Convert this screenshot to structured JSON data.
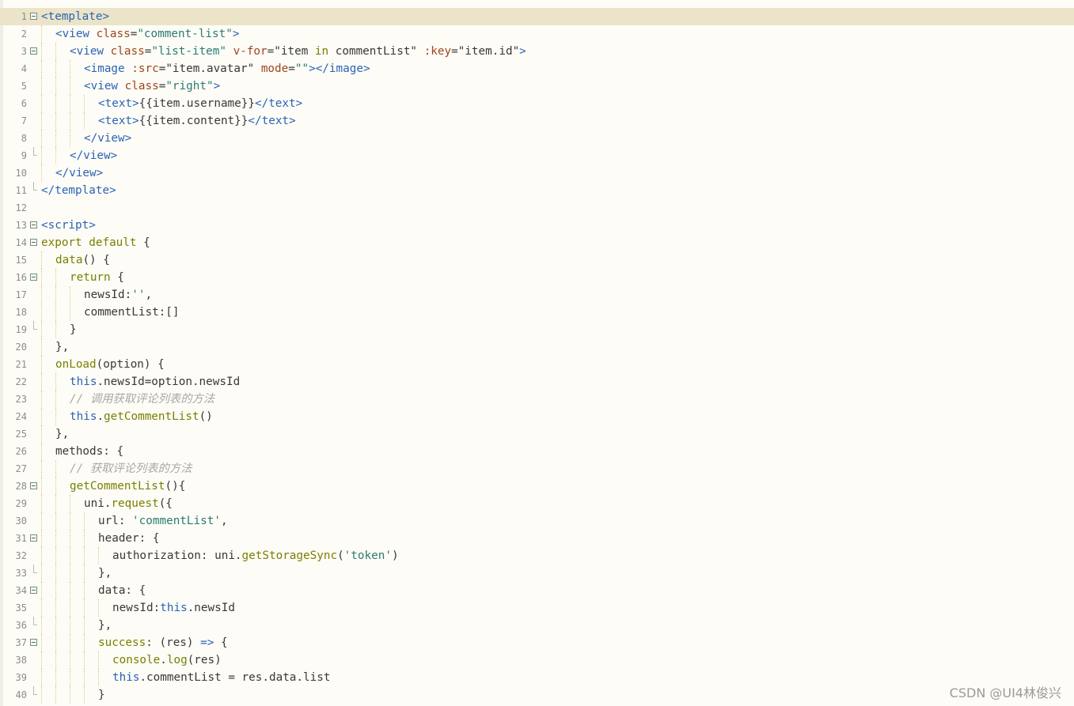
{
  "editor": {
    "lines": [
      {
        "n": "1",
        "fold": "box",
        "current": true,
        "indent": 0,
        "tokens": [
          [
            "tag",
            "<template>"
          ]
        ]
      },
      {
        "n": "2",
        "fold": "",
        "indent": 1,
        "tokens": [
          [
            "tag",
            "<view "
          ],
          [
            "attr",
            "class"
          ],
          [
            "punc",
            "="
          ],
          [
            "str",
            "\"comment-list\""
          ],
          [
            "tag",
            ">"
          ]
        ]
      },
      {
        "n": "3",
        "fold": "box",
        "indent": 2,
        "tokens": [
          [
            "tag",
            "<view "
          ],
          [
            "attr",
            "class"
          ],
          [
            "punc",
            "="
          ],
          [
            "str",
            "\"list-item\""
          ],
          [
            "plain",
            " "
          ],
          [
            "attr",
            "v-for"
          ],
          [
            "punc",
            "="
          ],
          [
            "plain",
            "\"item "
          ],
          [
            "kw",
            "in"
          ],
          [
            "plain",
            " commentList\" "
          ],
          [
            "attr",
            ":key"
          ],
          [
            "punc",
            "="
          ],
          [
            "plain",
            "\"item.id\""
          ],
          [
            "tag",
            ">"
          ]
        ]
      },
      {
        "n": "4",
        "fold": "",
        "indent": 3,
        "tokens": [
          [
            "tag",
            "<image "
          ],
          [
            "attr",
            ":src"
          ],
          [
            "punc",
            "="
          ],
          [
            "plain",
            "\"item.avatar\" "
          ],
          [
            "attr",
            "mode"
          ],
          [
            "punc",
            "="
          ],
          [
            "str",
            "\"\""
          ],
          [
            "tag",
            "></image>"
          ]
        ]
      },
      {
        "n": "5",
        "fold": "",
        "indent": 3,
        "tokens": [
          [
            "tag",
            "<view "
          ],
          [
            "attr",
            "class"
          ],
          [
            "punc",
            "="
          ],
          [
            "str",
            "\"right\""
          ],
          [
            "tag",
            ">"
          ]
        ]
      },
      {
        "n": "6",
        "fold": "",
        "indent": 4,
        "tokens": [
          [
            "tag",
            "<text>"
          ],
          [
            "plain",
            "{{item.username}}"
          ],
          [
            "tag",
            "</text>"
          ]
        ]
      },
      {
        "n": "7",
        "fold": "",
        "indent": 4,
        "tokens": [
          [
            "tag",
            "<text>"
          ],
          [
            "plain",
            "{{item.content}}"
          ],
          [
            "tag",
            "</text>"
          ]
        ]
      },
      {
        "n": "8",
        "fold": "",
        "indent": 3,
        "tokens": [
          [
            "tag",
            "</view>"
          ]
        ]
      },
      {
        "n": "9",
        "fold": "end",
        "indent": 2,
        "tokens": [
          [
            "tag",
            "</view>"
          ]
        ]
      },
      {
        "n": "10",
        "fold": "",
        "indent": 1,
        "tokens": [
          [
            "tag",
            "</view>"
          ]
        ]
      },
      {
        "n": "11",
        "fold": "end",
        "indent": 0,
        "tokens": [
          [
            "tag",
            "</template>"
          ]
        ]
      },
      {
        "n": "12",
        "fold": "",
        "indent": 0,
        "tokens": []
      },
      {
        "n": "13",
        "fold": "box",
        "indent": 0,
        "tokens": [
          [
            "tag",
            "<script>"
          ]
        ]
      },
      {
        "n": "14",
        "fold": "box",
        "indent": 0,
        "tokens": [
          [
            "kw",
            "export default"
          ],
          [
            "plain",
            " {"
          ]
        ]
      },
      {
        "n": "15",
        "fold": "",
        "indent": 1,
        "tokens": [
          [
            "fn",
            "data"
          ],
          [
            "plain",
            "() {"
          ]
        ]
      },
      {
        "n": "16",
        "fold": "box",
        "indent": 2,
        "tokens": [
          [
            "kw",
            "return"
          ],
          [
            "plain",
            " {"
          ]
        ]
      },
      {
        "n": "17",
        "fold": "",
        "indent": 3,
        "tokens": [
          [
            "plain",
            "newsId:"
          ],
          [
            "str",
            "''"
          ],
          [
            "plain",
            ","
          ]
        ]
      },
      {
        "n": "18",
        "fold": "",
        "indent": 3,
        "tokens": [
          [
            "plain",
            "commentList:[]"
          ]
        ]
      },
      {
        "n": "19",
        "fold": "end",
        "indent": 2,
        "tokens": [
          [
            "plain",
            "}"
          ]
        ]
      },
      {
        "n": "20",
        "fold": "",
        "indent": 1,
        "tokens": [
          [
            "plain",
            "},"
          ]
        ]
      },
      {
        "n": "21",
        "fold": "",
        "indent": 1,
        "tokens": [
          [
            "fn",
            "onLoad"
          ],
          [
            "plain",
            "(option) {"
          ]
        ]
      },
      {
        "n": "22",
        "fold": "",
        "indent": 2,
        "tokens": [
          [
            "this",
            "this"
          ],
          [
            "plain",
            ".newsId=option.newsId"
          ]
        ]
      },
      {
        "n": "23",
        "fold": "",
        "indent": 2,
        "tokens": [
          [
            "com",
            "// 调用获取评论列表的方法"
          ]
        ]
      },
      {
        "n": "24",
        "fold": "",
        "indent": 2,
        "tokens": [
          [
            "this",
            "this"
          ],
          [
            "plain",
            "."
          ],
          [
            "fn",
            "getCommentList"
          ],
          [
            "plain",
            "()"
          ]
        ]
      },
      {
        "n": "25",
        "fold": "",
        "indent": 1,
        "tokens": [
          [
            "plain",
            "},"
          ]
        ]
      },
      {
        "n": "26",
        "fold": "",
        "indent": 1,
        "tokens": [
          [
            "plain",
            "methods: {"
          ]
        ]
      },
      {
        "n": "27",
        "fold": "",
        "indent": 2,
        "tokens": [
          [
            "com",
            "// 获取评论列表的方法"
          ]
        ]
      },
      {
        "n": "28",
        "fold": "box",
        "indent": 2,
        "tokens": [
          [
            "fn",
            "getCommentList"
          ],
          [
            "plain",
            "(){"
          ]
        ]
      },
      {
        "n": "29",
        "fold": "",
        "indent": 3,
        "tokens": [
          [
            "plain",
            "uni."
          ],
          [
            "fn",
            "request"
          ],
          [
            "plain",
            "({"
          ]
        ]
      },
      {
        "n": "30",
        "fold": "",
        "indent": 4,
        "tokens": [
          [
            "plain",
            "url: "
          ],
          [
            "str",
            "'commentList'"
          ],
          [
            "plain",
            ","
          ]
        ]
      },
      {
        "n": "31",
        "fold": "box",
        "indent": 4,
        "tokens": [
          [
            "plain",
            "header: {"
          ]
        ]
      },
      {
        "n": "32",
        "fold": "",
        "indent": 5,
        "tokens": [
          [
            "plain",
            "authorization: uni."
          ],
          [
            "fn",
            "getStorageSync"
          ],
          [
            "plain",
            "("
          ],
          [
            "str",
            "'token'"
          ],
          [
            "plain",
            ")"
          ]
        ]
      },
      {
        "n": "33",
        "fold": "end",
        "indent": 4,
        "tokens": [
          [
            "plain",
            "},"
          ]
        ]
      },
      {
        "n": "34",
        "fold": "box",
        "indent": 4,
        "tokens": [
          [
            "plain",
            "data: {"
          ]
        ]
      },
      {
        "n": "35",
        "fold": "",
        "indent": 5,
        "tokens": [
          [
            "plain",
            "newsId:"
          ],
          [
            "this",
            "this"
          ],
          [
            "plain",
            ".newsId"
          ]
        ]
      },
      {
        "n": "36",
        "fold": "end",
        "indent": 4,
        "tokens": [
          [
            "plain",
            "},"
          ]
        ]
      },
      {
        "n": "37",
        "fold": "box",
        "indent": 4,
        "tokens": [
          [
            "fn",
            "success"
          ],
          [
            "plain",
            ": (res) "
          ],
          [
            "this",
            "=>"
          ],
          [
            "plain",
            " {"
          ]
        ]
      },
      {
        "n": "38",
        "fold": "",
        "indent": 5,
        "tokens": [
          [
            "fn",
            "console"
          ],
          [
            "plain",
            "."
          ],
          [
            "fn",
            "log"
          ],
          [
            "plain",
            "(res)"
          ]
        ]
      },
      {
        "n": "39",
        "fold": "",
        "indent": 5,
        "tokens": [
          [
            "this",
            "this"
          ],
          [
            "plain",
            ".commentList = res.data.list"
          ]
        ]
      },
      {
        "n": "40",
        "fold": "end",
        "indent": 4,
        "tokens": [
          [
            "plain",
            "}"
          ]
        ]
      }
    ]
  },
  "watermark": "CSDN @UI4林俊兴"
}
